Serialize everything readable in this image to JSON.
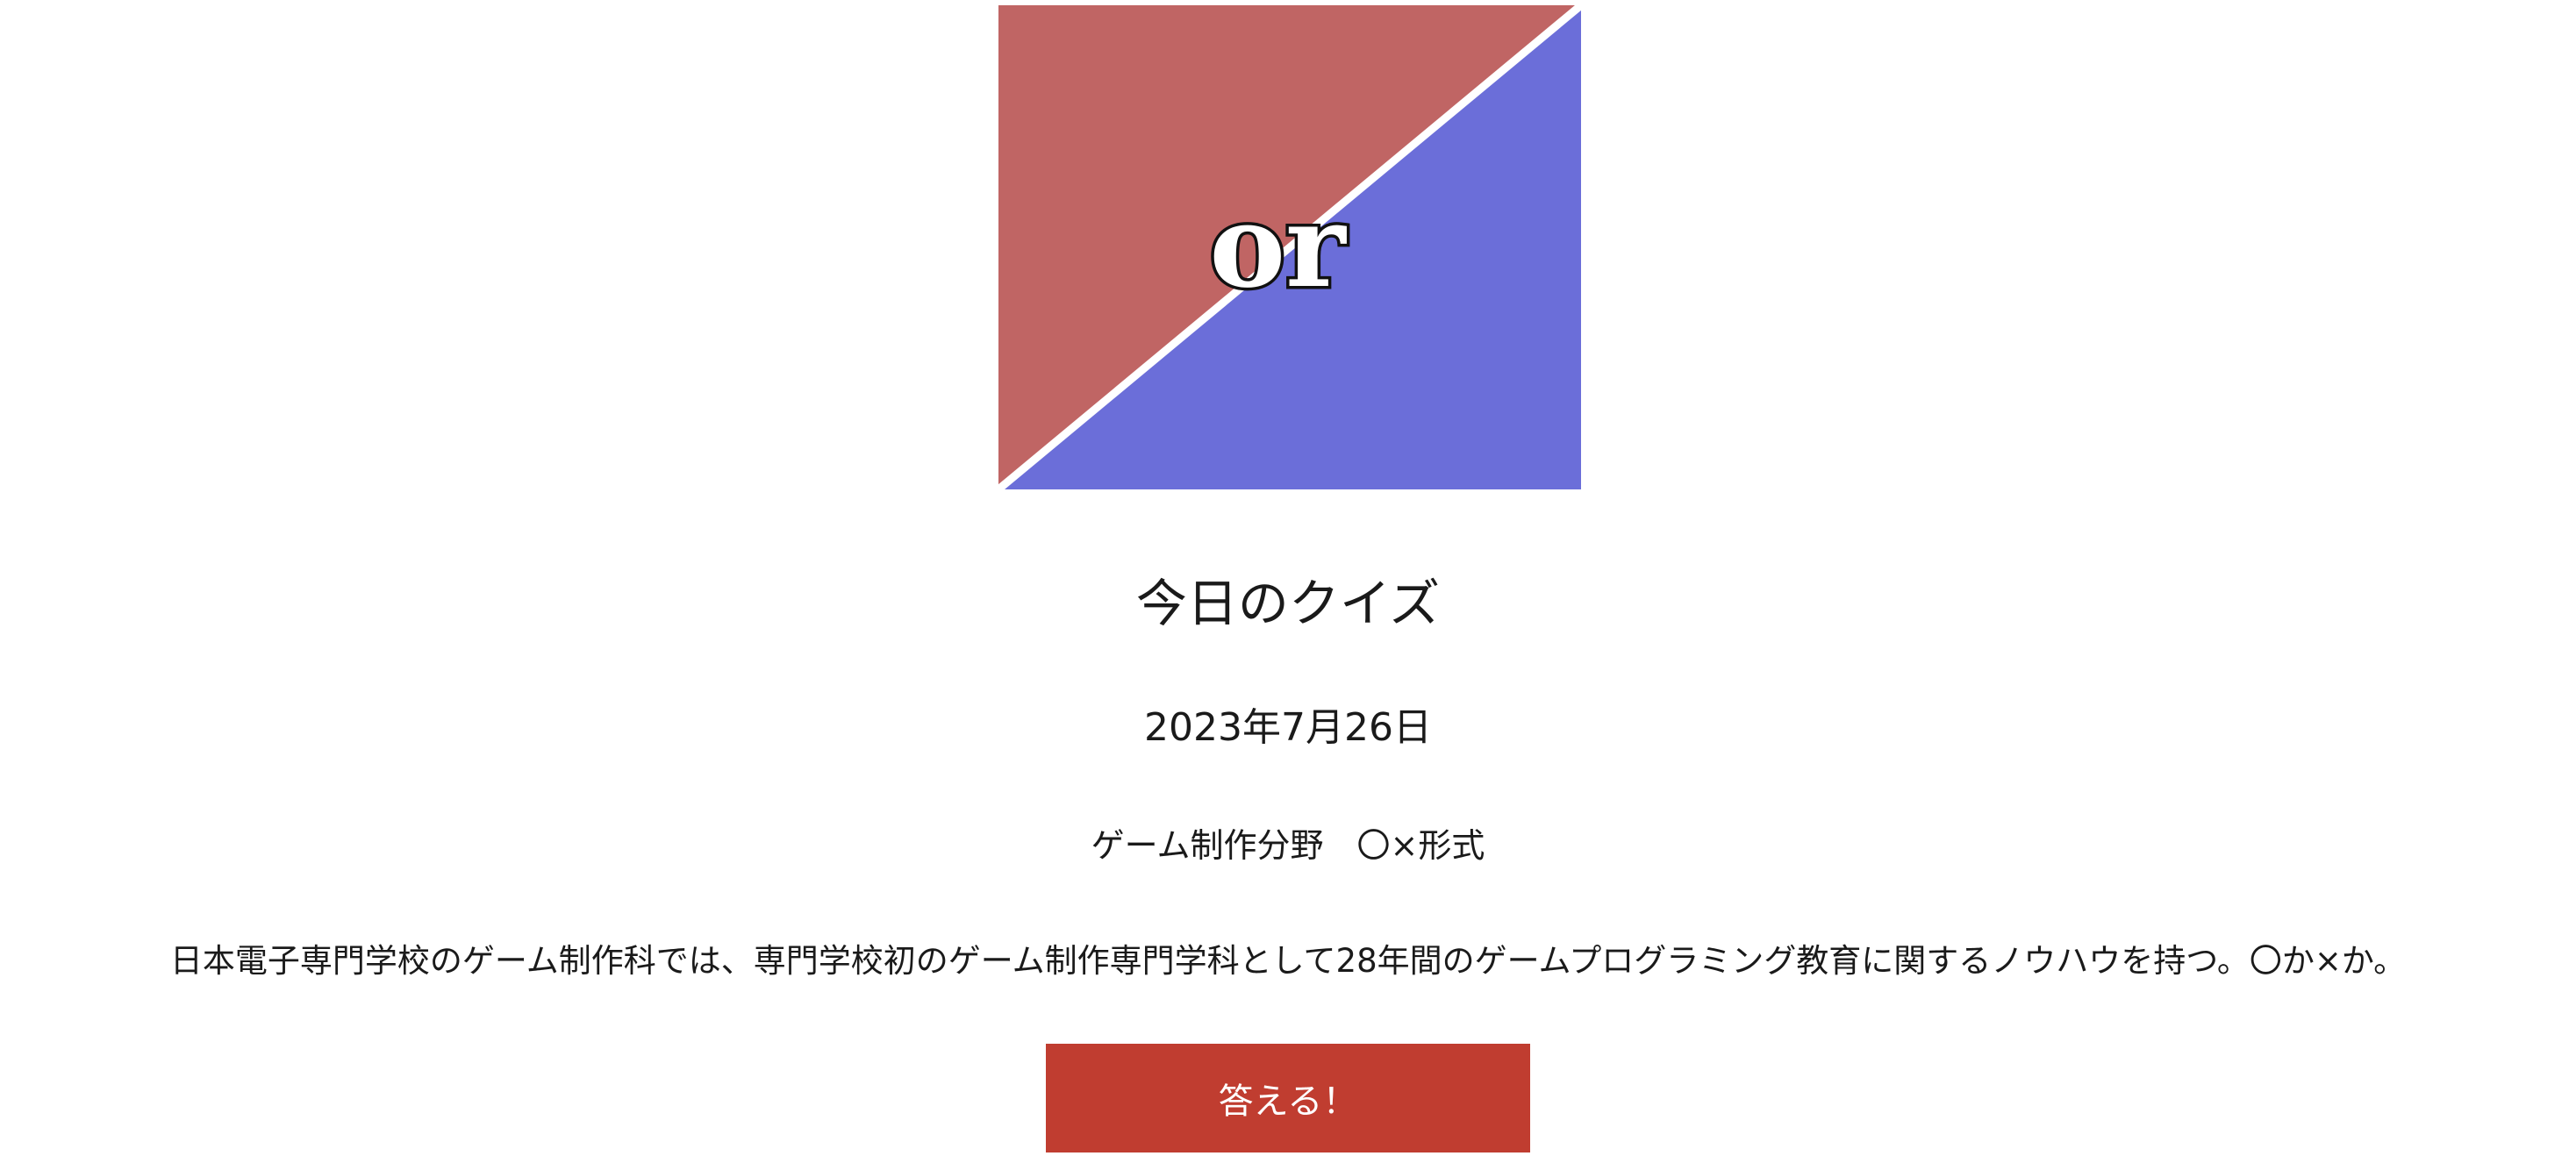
{
  "hero": {
    "text": "or",
    "colors": {
      "left": "#c06564",
      "right": "#6b6ed9",
      "divider": "#ffffff"
    }
  },
  "quiz": {
    "title": "今日のクイズ",
    "date": "2023年7月26日",
    "category": "ゲーム制作分野　〇×形式",
    "question": "日本電子専門学校のゲーム制作科では、専門学校初のゲーム制作専門学科として28年間のゲームプログラミング教育に関するノウハウを持つ。〇か×か。",
    "answer_label": "答える！",
    "button_color": "#c03d30"
  }
}
